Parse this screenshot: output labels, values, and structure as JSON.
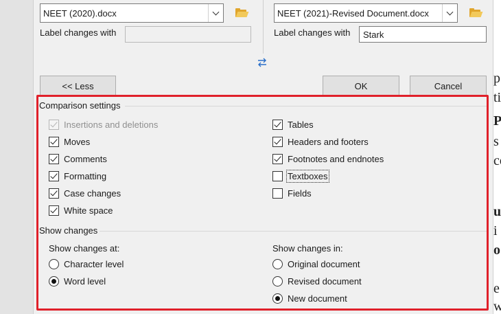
{
  "original_file": {
    "value": "NEET (2020).docx",
    "label": "Label changes with",
    "label_value": ""
  },
  "revised_file": {
    "value": "NEET (2021)-Revised Document.docx",
    "label": "Label changes with",
    "label_value": "Stark"
  },
  "buttons": {
    "less": "<< Less",
    "ok": "OK",
    "cancel": "Cancel"
  },
  "comparison": {
    "title": "Comparison settings",
    "left": [
      {
        "label": "Insertions and deletions",
        "checked": true,
        "disabled": true
      },
      {
        "label": "Moves",
        "checked": true
      },
      {
        "label": "Comments",
        "checked": true
      },
      {
        "label": "Formatting",
        "checked": true
      },
      {
        "label": "Case changes",
        "checked": true
      },
      {
        "label": "White space",
        "checked": true
      }
    ],
    "right": [
      {
        "label": "Tables",
        "checked": true
      },
      {
        "label": "Headers and footers",
        "checked": true
      },
      {
        "label": "Footnotes and endnotes",
        "checked": true
      },
      {
        "label": "Textboxes",
        "checked": false
      },
      {
        "label": "Fields",
        "checked": false
      }
    ]
  },
  "show_changes": {
    "title": "Show changes",
    "at": {
      "label": "Show changes at:",
      "options": [
        {
          "label": "Character level",
          "selected": false
        },
        {
          "label": "Word level",
          "selected": true
        }
      ]
    },
    "in": {
      "label": "Show changes in:",
      "options": [
        {
          "label": "Original document",
          "selected": false
        },
        {
          "label": "Revised document",
          "selected": false
        },
        {
          "label": "New document",
          "selected": true
        }
      ]
    }
  },
  "background_fragments": [
    "p",
    "tic",
    "P",
    "s",
    "co",
    "u",
    "i",
    "o",
    "e",
    "w"
  ],
  "colors": {
    "highlight": "#e0202a",
    "dialog": "#f0f0f0",
    "folder": "#e0a52c"
  },
  "icons": {
    "folder": "folder-open-icon",
    "swap": "swap-arrows-icon",
    "dropdown": "chevron-down-icon"
  }
}
